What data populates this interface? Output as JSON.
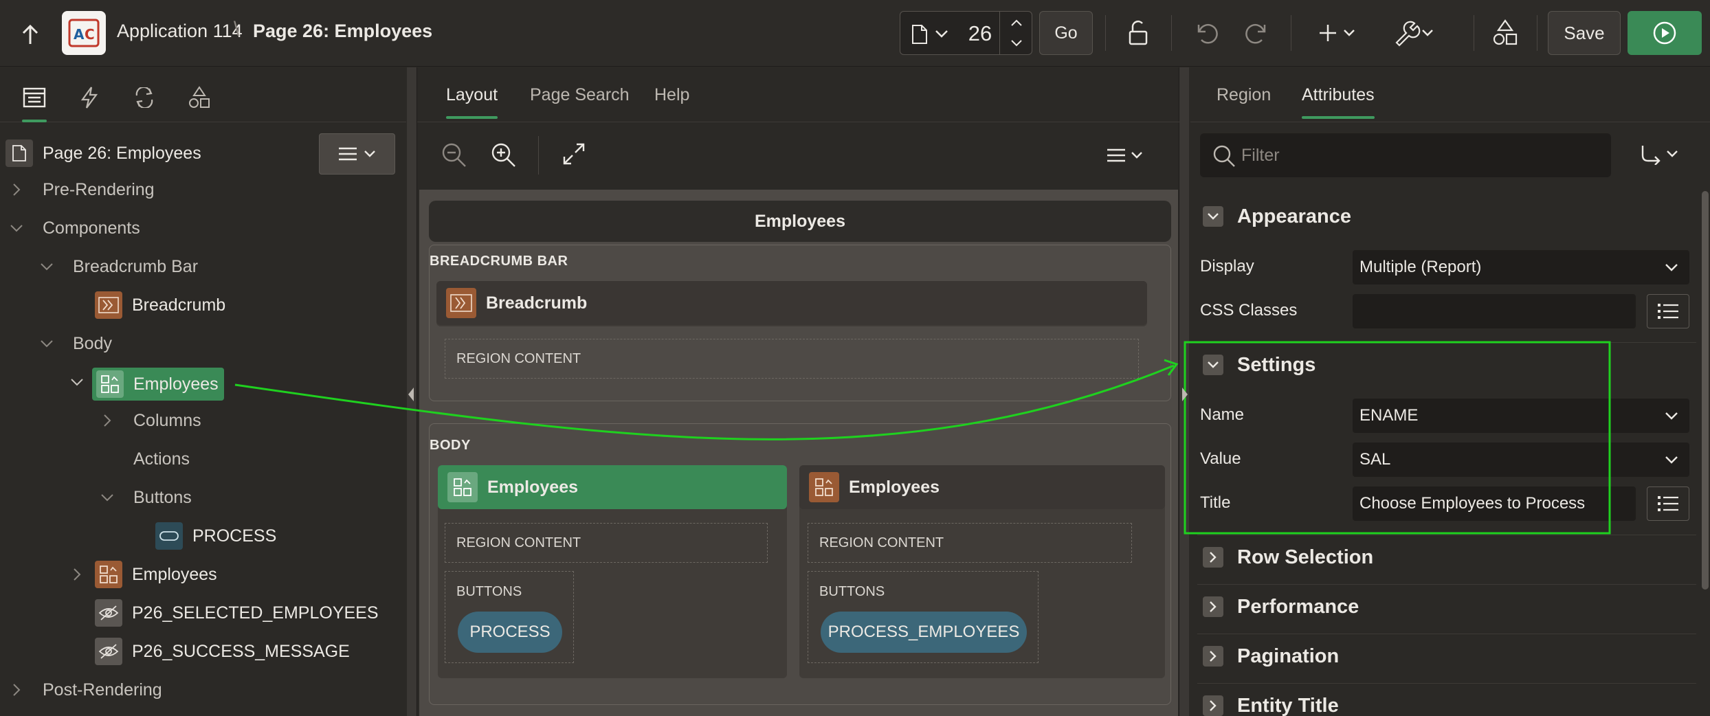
{
  "header": {
    "app_name": "Application 114",
    "separator": "\\",
    "page_name": "Page 26: Employees",
    "page_number": "26",
    "go_label": "Go",
    "save_label": "Save"
  },
  "left_panel": {
    "tree": {
      "root": "Page 26: Employees",
      "pre_rendering": "Pre-Rendering",
      "components": "Components",
      "breadcrumb_bar": "Breadcrumb Bar",
      "breadcrumb": "Breadcrumb",
      "body": "Body",
      "employees_selected": "Employees",
      "columns": "Columns",
      "actions": "Actions",
      "buttons": "Buttons",
      "process": "PROCESS",
      "employees_2": "Employees",
      "item_selected": "P26_SELECTED_EMPLOYEES",
      "item_success": "P26_SUCCESS_MESSAGE",
      "post_rendering": "Post-Rendering"
    }
  },
  "middle_panel": {
    "tabs": [
      "Layout",
      "Page Search",
      "Help"
    ],
    "page_title": "Employees",
    "breadcrumb_bar_label": "BREADCRUMB BAR",
    "breadcrumb_region": "Breadcrumb",
    "region_content": "REGION CONTENT",
    "body_label": "BODY",
    "employees_region_1": "Employees",
    "employees_region_2": "Employees",
    "buttons_label": "BUTTONS",
    "process_button": "PROCESS",
    "process_employees_button": "PROCESS_EMPLOYEES"
  },
  "right_panel": {
    "tabs": [
      "Region",
      "Attributes"
    ],
    "filter_placeholder": "Filter",
    "groups": {
      "appearance": "Appearance",
      "settings": "Settings",
      "row_selection": "Row Selection",
      "performance": "Performance",
      "pagination": "Pagination",
      "entity_title": "Entity Title"
    },
    "props": {
      "display_label": "Display",
      "display_value": "Multiple (Report)",
      "css_label": "CSS Classes",
      "css_value": "",
      "name_label": "Name",
      "name_value": "ENAME",
      "value_label": "Value",
      "value_value": "SAL",
      "title_label": "Title",
      "title_value": "Choose Employees to Process"
    }
  },
  "colors": {
    "accent_green": "#3a8a56",
    "annotation_green": "#1fd11f",
    "region_brown": "#9a5a34",
    "button_teal": "#3c6779"
  }
}
